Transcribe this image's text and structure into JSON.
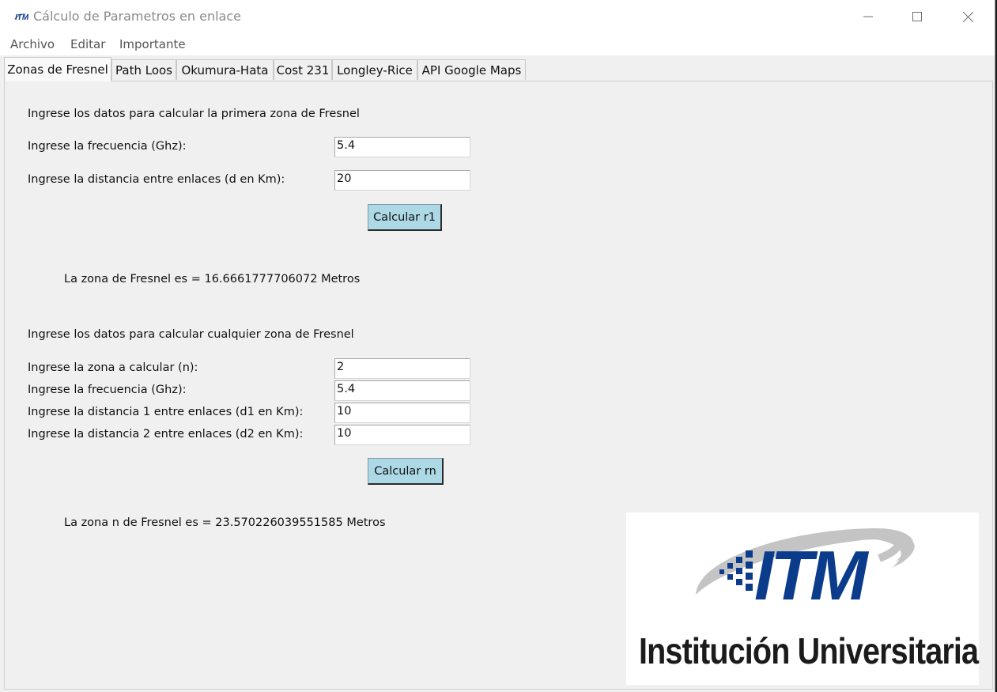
{
  "window": {
    "title": "Cálculo de Parametros en enlace",
    "app_icon": "itm-app-icon",
    "controls": [
      "minimize-icon",
      "maximize-icon",
      "close-icon"
    ]
  },
  "menu": {
    "items": [
      "Archivo",
      "Editar",
      "Importante"
    ]
  },
  "tabs": [
    {
      "label": "Zonas de Fresnel",
      "active": true
    },
    {
      "label": "Path Loos",
      "active": false
    },
    {
      "label": "Okumura-Hata",
      "active": false
    },
    {
      "label": "Cost 231",
      "active": false
    },
    {
      "label": "Longley-Rice",
      "active": false
    },
    {
      "label": "API Google Maps",
      "active": false
    }
  ],
  "section1": {
    "heading": "Ingrese los datos para calcular la primera zona de Fresnel",
    "freq_label": "Ingrese la frecuencia (Ghz):",
    "freq_value": "5.4",
    "dist_label": "Ingrese la distancia entre enlaces (d en Km):",
    "dist_value": "20",
    "button": "Calcular r1",
    "result": "La zona de Fresnel es =  16.6661777706072 Metros"
  },
  "section2": {
    "heading": "Ingrese los datos para calcular cualquier zona de Fresnel",
    "zone_label": "Ingrese la zona a calcular (n):",
    "zone_value": "2",
    "freq_label": "Ingrese la frecuencia (Ghz):",
    "freq_value": "5.4",
    "d1_label": "Ingrese la distancia 1 entre enlaces (d1 en Km):",
    "d1_value": "10",
    "d2_label": "Ingrese la distancia 2 entre enlaces (d2 en Km):",
    "d2_value": "10",
    "button": "Calcular rn",
    "result": "La zona n de Fresnel es =   23.570226039551585 Metros"
  },
  "logo": {
    "mark": "ITM",
    "text": "Institución Universitaria",
    "colors": {
      "blue": "#0b3c8c",
      "gray": "#c4c4c4",
      "text": "#1b1b1b"
    }
  },
  "colors": {
    "button_bg": "#add8e6",
    "window_bg": "#f0f0f0"
  }
}
